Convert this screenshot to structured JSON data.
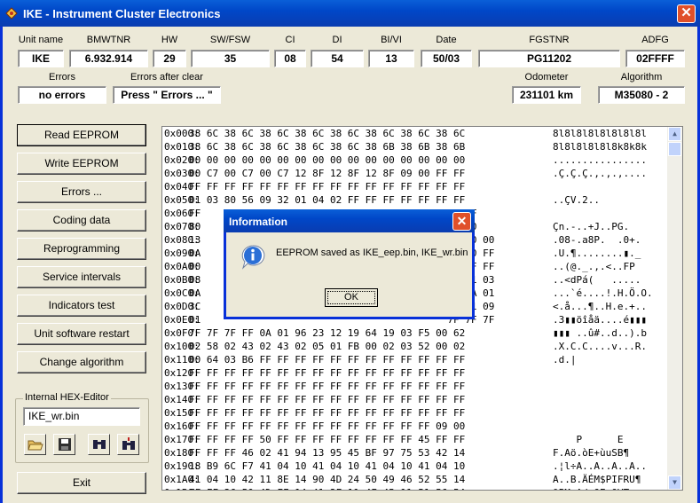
{
  "window": {
    "title": "IKE - Instrument Cluster Electronics",
    "close": "✕"
  },
  "fields": [
    {
      "label": "Unit name",
      "value": "IKE"
    },
    {
      "label": "BMWTNR",
      "value": "6.932.914"
    },
    {
      "label": "HW",
      "value": "29"
    },
    {
      "label": "SW/FSW",
      "value": "35"
    },
    {
      "label": "CI",
      "value": "08"
    },
    {
      "label": "DI",
      "value": "54"
    },
    {
      "label": "BI/VI",
      "value": "13"
    },
    {
      "label": "Date",
      "value": "50/03"
    },
    {
      "label": "FGSTNR",
      "value": "PG11202"
    },
    {
      "label": "ADFG",
      "value": "02FFFF"
    }
  ],
  "row2": [
    {
      "label": "Errors",
      "value": "no errors"
    },
    {
      "label": "Errors after clear",
      "value": "Press \" Errors ... \""
    },
    {
      "label": "Odometer",
      "value": "231101 km"
    },
    {
      "label": "Algorithm",
      "value": "M35080 - 2"
    }
  ],
  "buttons": [
    "Read EEPROM",
    "Write EEPROM",
    "Errors ...",
    "Coding data",
    "Reprogramming",
    "Service intervals",
    "Indicators test",
    "Unit software restart",
    "Change algorithm"
  ],
  "hex_editor": {
    "label": "Internal HEX-Editor",
    "file": "IKE_wr.bin",
    "icons": [
      "open-folder-icon",
      "save-icon",
      "find-icon",
      "find-next-icon"
    ]
  },
  "exit_label": "Exit",
  "hex_rows": [
    {
      "addr": "0x000:",
      "bytes": "38 6C 38 6C 38 6C 38 6C 38 6C 38 6C 38 6C 38 6C",
      "ascii": "8l8l8l8l8l8l8l8l"
    },
    {
      "addr": "0x010:",
      "bytes": "38 6C 38 6C 38 6C 38 6C 38 6C 38 6B 38 6B 38 6B",
      "ascii": "8l8l8l8l8l8k8k8k"
    },
    {
      "addr": "0x020:",
      "bytes": "00 00 00 00 00 00 00 00 00 00 00 00 00 00 00 00",
      "ascii": "................"
    },
    {
      "addr": "0x030:",
      "bytes": "00 C7 00 C7 00 C7 12 8F 12 8F 12 8F 09 00 FF FF",
      "ascii": ".Ç.Ç.Ç.‚.‚.‚...."
    },
    {
      "addr": "0x040:",
      "bytes": "FF FF FF FF FF FF FF FF FF FF FF FF FF FF FF FF",
      "ascii": ""
    },
    {
      "addr": "0x050:",
      "bytes": "01 03 80 56 09 32 01 04 02 FF FF FF FF FF FF FF",
      "ascii": "..ÇV.2.."
    },
    {
      "addr": "0x060:",
      "bytes": "FF                                          FF FF",
      "ascii": ""
    },
    {
      "addr": "0x070:",
      "bytes": "80                                          20 20",
      "ascii": "Çn.-..+J..PG."
    },
    {
      "addr": "0x080:",
      "bytes": "13                                          D4 00 00",
      "ascii": ".08-.a8P.  .0+."
    },
    {
      "addr": "0x090:",
      "bytes": "0A                                          5F 00 FF",
      "ascii": ".U.¶........▮._"
    },
    {
      "addr": "0x0A0:",
      "bytes": "00                                          50 FF FF",
      "ascii": "..(@._.,.<..FP"
    },
    {
      "addr": "0x0B0:",
      "bytes": "08                                          02 01 03",
      "ascii": "..<dPá(   ....."
    },
    {
      "addr": "0x0C0:",
      "bytes": "0A                                          00 EA 01",
      "ascii": "...`é....!.H.Ö.O."
    },
    {
      "addr": "0x0D0:",
      "bytes": "3C                                          C8 01 09",
      "ascii": "<.å...¶..H.e.+.."
    },
    {
      "addr": "0x0E0:",
      "bytes": "01                                          7F 7F 7F",
      "ascii": ".3▮▮öîåä....é▮▮▮"
    },
    {
      "addr": "0x0F0:",
      "bytes": "7F 7F 7F FF 0A 01 96 23 12 19 64 19 03 F5 00 62",
      "ascii": "▮▮▮ ..û#..d..).b"
    },
    {
      "addr": "0x100:",
      "bytes": "02 58 02 43 02 43 02 05 01 FB 00 02 03 52 00 02",
      "ascii": ".X.C.C....v...R."
    },
    {
      "addr": "0x110:",
      "bytes": "00 64 03 B6 FF FF FF FF FF FF FF FF FF FF FF FF",
      "ascii": ".d.|"
    },
    {
      "addr": "0x120:",
      "bytes": "FF FF FF FF FF FF FF FF FF FF FF FF FF FF FF FF",
      "ascii": ""
    },
    {
      "addr": "0x130:",
      "bytes": "FF FF FF FF FF FF FF FF FF FF FF FF FF FF FF FF",
      "ascii": ""
    },
    {
      "addr": "0x140:",
      "bytes": "FF FF FF FF FF FF FF FF FF FF FF FF FF FF FF FF",
      "ascii": ""
    },
    {
      "addr": "0x150:",
      "bytes": "FF FF FF FF FF FF FF FF FF FF FF FF FF FF FF FF",
      "ascii": ""
    },
    {
      "addr": "0x160:",
      "bytes": "FF FF FF FF FF FF FF FF FF FF FF FF FF FF 09 00",
      "ascii": ""
    },
    {
      "addr": "0x170:",
      "bytes": "FF FF FF FF 50 FF FF FF FF FF FF FF FF 45 FF FF",
      "ascii": "    P      E"
    },
    {
      "addr": "0x180:",
      "bytes": "FF FF FF 46 02 41 94 13 95 45 BF 97 75 53 42 14",
      "ascii": "F.Aö.òE+ùuSB¶"
    },
    {
      "addr": "0x190:",
      "bytes": "18 B9 6C F7 41 04 10 41 04 10 41 04 10 41 04 10",
      "ascii": ".¦l÷A..A..A..A.."
    },
    {
      "addr": "0x1A0:",
      "bytes": "41 04 10 42 11 8E 14 90 4D 24 50 49 46 52 55 14",
      "ascii": "A..B.ÄÉM$PIFRU¶"
    },
    {
      "addr": "0x1B0:",
      "bytes": "FF FF 26 50 4D FF 14 41 2F 11 4F 45 11 51 56 54",
      "ascii": "&PM.A/.OE.QVT"
    }
  ],
  "dialog": {
    "title": "Information",
    "message": "EEPROM saved as IKE_eep.bin, IKE_wr.bin",
    "ok": "OK",
    "close": "✕"
  }
}
